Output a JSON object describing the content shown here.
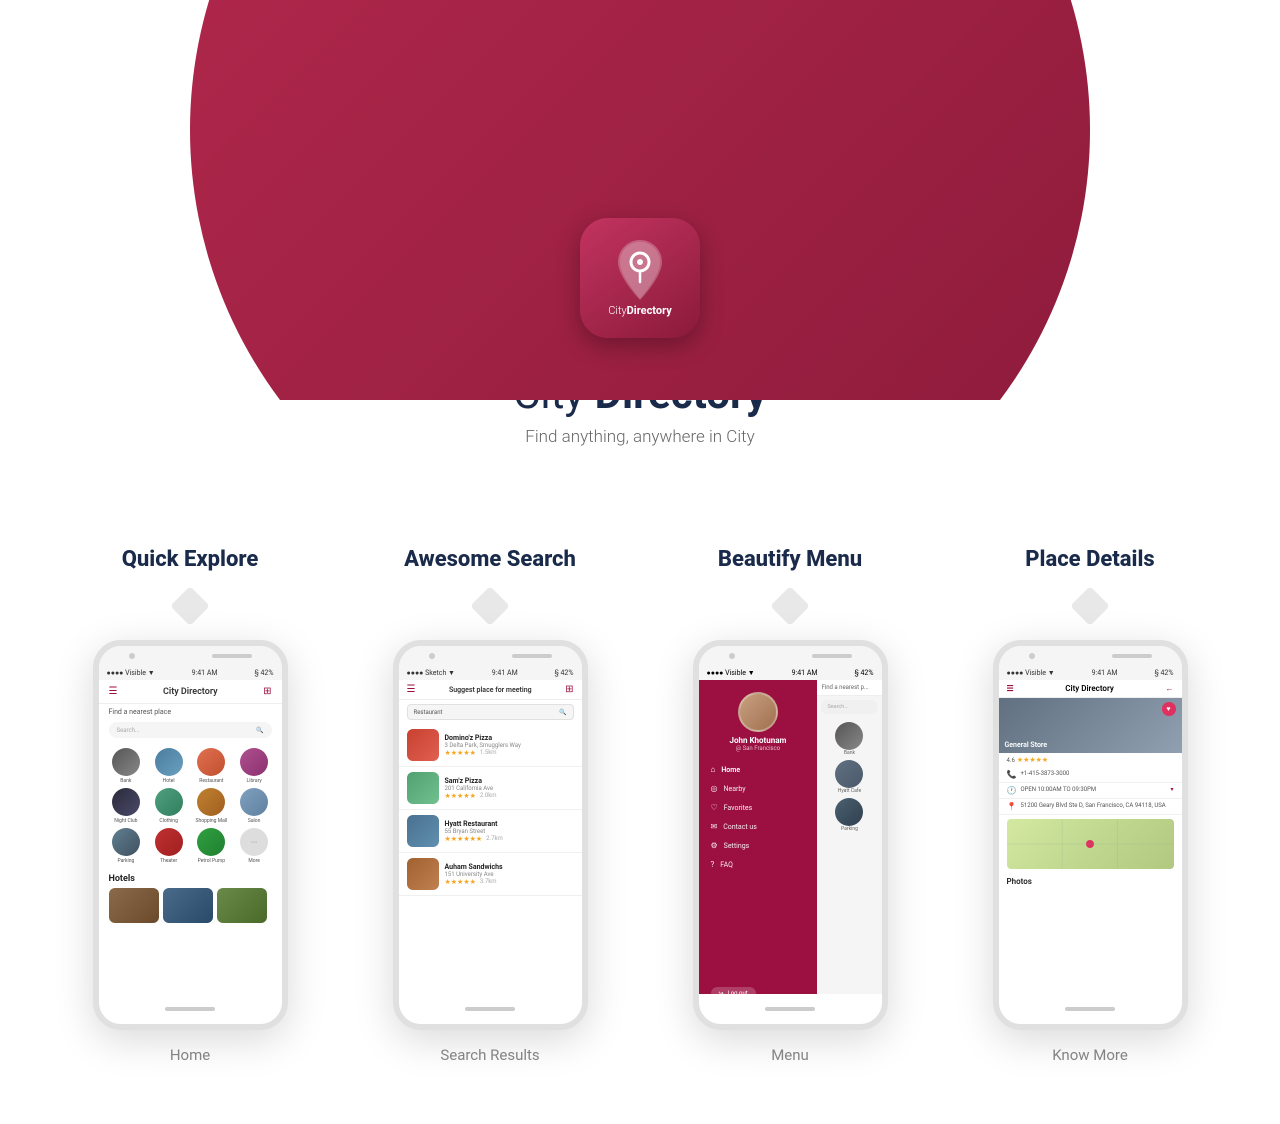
{
  "hero": {
    "app_icon_text_normal": "City",
    "app_icon_text_bold": "Directory",
    "title_normal": "City ",
    "title_bold": "Directory",
    "subtitle": "Find anything, anywhere in City"
  },
  "features": [
    {
      "title": "Quick Explore",
      "label": "Home",
      "phone": {
        "status_left": "●●●● Visible ▼",
        "status_center": "9:41 AM",
        "status_right": "§ 42%",
        "app_title": "City Directory",
        "subtitle": "Find a nearest place",
        "search_placeholder": "Search...",
        "categories": [
          {
            "label": "Bank",
            "color": "c-bank"
          },
          {
            "label": "Hotel",
            "color": "c-hotel"
          },
          {
            "label": "Restaurant",
            "color": "c-restaurant"
          },
          {
            "label": "Library",
            "color": "c-library"
          },
          {
            "label": "Night Club",
            "color": "c-nightclub"
          },
          {
            "label": "Clothing",
            "color": "c-clothing"
          },
          {
            "label": "Shopping Mall",
            "color": "c-shopping"
          },
          {
            "label": "Salon",
            "color": "c-salon"
          },
          {
            "label": "Parking",
            "color": "c-parking"
          },
          {
            "label": "Theater",
            "color": "c-theater"
          },
          {
            "label": "Petrol Pump",
            "color": "c-petrol"
          },
          {
            "label": "More",
            "color": "c-more"
          }
        ],
        "section_title": "Hotels"
      }
    },
    {
      "title": "Awesome Search",
      "label": "Search Results",
      "phone": {
        "status_left": "●●●● Sketch ▼",
        "status_center": "9:41 AM",
        "status_right": "§ 42%",
        "app_title": "Suggest place for meeting",
        "search_value": "Restaurant",
        "results": [
          {
            "name": "Domino'z Pizza",
            "address": "3 Delta Park, Smugglers Way",
            "stars": "★★★★★",
            "dist": "1.5km"
          },
          {
            "name": "Sam'z Pizza",
            "address": "201 California Ave",
            "stars": "★★★★★",
            "dist": "2.0km"
          },
          {
            "name": "Hyatt Restaurant",
            "address": "55 Bryan Street",
            "stars": "★★★★★★",
            "dist": "2.7km"
          },
          {
            "name": "Auham Sandwichs",
            "address": "151 University Ave",
            "stars": "★★★★★",
            "dist": "3.7km"
          }
        ]
      }
    },
    {
      "title": "Beautify Menu",
      "label": "Menu",
      "phone": {
        "status_left": "●●●● Visible ▼",
        "status_center": "9:41 AM",
        "status_right": "§ 42%",
        "user_name": "John Khotunam",
        "user_location": "@ San Francisco",
        "menu_items": [
          {
            "icon": "⌂",
            "label": "Home"
          },
          {
            "icon": "◎",
            "label": "Nearby"
          },
          {
            "icon": "♡",
            "label": "Favorites"
          },
          {
            "icon": "✉",
            "label": "Contact us"
          },
          {
            "icon": "⚙",
            "label": "Settings"
          },
          {
            "icon": "?",
            "label": "FAQ"
          }
        ],
        "search_placeholder": "Search...",
        "right_categories": [
          {
            "label": "Bank",
            "color": "#888"
          },
          {
            "label": "Hyatt Cafe",
            "color": "#607080"
          },
          {
            "label": "Parking",
            "color": "#4a6070"
          }
        ]
      }
    },
    {
      "title": "Place Details",
      "label": "Know More",
      "phone": {
        "status_left": "●●●● Visible ▼",
        "status_center": "9:41 AM",
        "status_right": "§ 42%",
        "app_title": "City Directory",
        "store_name": "General Store",
        "rating": "4.6",
        "stars": "★★★★★",
        "phone_number": "+1-415-3873-3000",
        "hours": "OPEN 10:00AM TO 09:30PM",
        "address": "51200 Geary Blvd Ste D, San Francisco, CA 94118, USA",
        "photos_label": "Photos"
      }
    }
  ]
}
